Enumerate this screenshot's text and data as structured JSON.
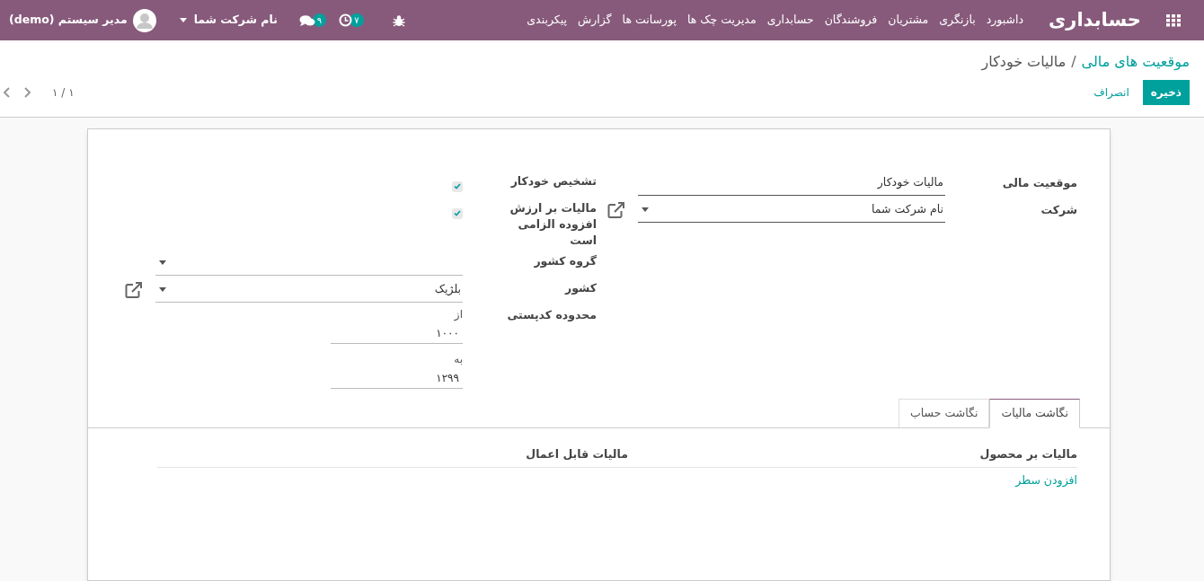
{
  "navbar": {
    "app_title": "حسابداری",
    "menu": [
      "داشبورد",
      "بازنگری",
      "مشتریان",
      "فروشندگان",
      "حسابداری",
      "مدیریت چک ها",
      "پورسانت ها",
      "گزارش",
      "پیکربندی"
    ],
    "activity_count": "۷",
    "message_count": "۹",
    "company": "نام شرکت شما",
    "user": "مدیر سیستم (demo)"
  },
  "breadcrumb": [
    {
      "label": "موقعیت های مالی",
      "kind": "link"
    },
    {
      "label": "مالیات خودکار",
      "kind": "current"
    }
  ],
  "breadcrumb_separator": "/",
  "buttons": [
    {
      "label": "ذخیره",
      "kind": "primary"
    },
    {
      "label": "انصراف",
      "kind": "link"
    }
  ],
  "pager": "۱ / ۱",
  "form": {
    "right_fields": [
      {
        "label": "موقعیت مالی",
        "kind": "text",
        "value": "مالیات خودکار"
      },
      {
        "label": "شرکت",
        "kind": "many2one",
        "value": "نام شرکت شما"
      }
    ],
    "left_fields": [
      {
        "label": "تشخیص خودکار",
        "kind": "checkbox",
        "checked": true
      },
      {
        "label": "مالیات بر ارزش افزوده الزامی است",
        "kind": "checkbox",
        "checked": true
      },
      {
        "label": "گروه کشور",
        "kind": "select"
      },
      {
        "label": "کشور",
        "kind": "many2one",
        "value": "بلژیک"
      },
      {
        "label": "محدوده کدپستی",
        "kind": "range",
        "from_label": "از",
        "from": "۱۰۰۰",
        "to_label": "به",
        "to": "۱۲۹۹"
      }
    ]
  },
  "tabs": [
    {
      "label": "نگاشت مالیات",
      "selected": true
    },
    {
      "label": "نگاشت حساب",
      "selected": false
    }
  ],
  "table": {
    "columns": [
      "مالیات بر محصول",
      "مالیات قابل اعمال"
    ],
    "add_line": "افزودن سطر"
  }
}
